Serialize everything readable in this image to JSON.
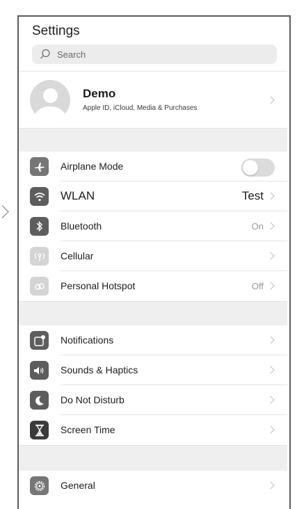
{
  "settings": {
    "title": "Settings",
    "search_placeholder": "Search",
    "profile": {
      "name": "Demo",
      "subtitle": "Apple ID, iCloud, Media & Purchases"
    },
    "group1": [
      {
        "label": "Airplane Mode",
        "icon": "airplane-icon",
        "control": "toggle",
        "toggle_on": false
      },
      {
        "label": "WLAN",
        "icon": "wifi-icon",
        "value": "Test"
      },
      {
        "label": "Bluetooth",
        "icon": "bluetooth-icon",
        "value": "On"
      },
      {
        "label": "Cellular",
        "icon": "cellular-icon",
        "value": ""
      },
      {
        "label": "Personal Hotspot",
        "icon": "hotspot-icon",
        "value": "Off"
      }
    ],
    "group2": [
      {
        "label": "Notifications",
        "icon": "notifications-icon"
      },
      {
        "label": "Sounds & Haptics",
        "icon": "sound-icon"
      },
      {
        "label": "Do Not Disturb",
        "icon": "moon-icon"
      },
      {
        "label": "Screen Time",
        "icon": "hourglass-icon"
      }
    ],
    "group3": [
      {
        "label": "General",
        "icon": "gear-icon"
      }
    ]
  }
}
